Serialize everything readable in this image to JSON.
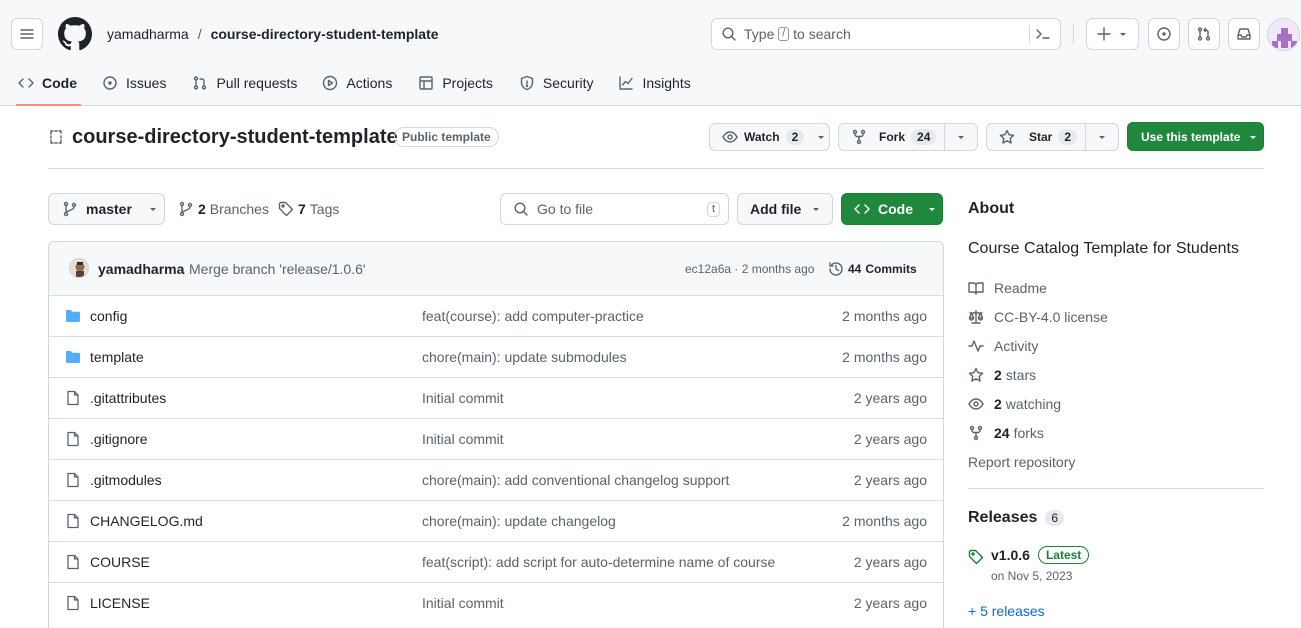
{
  "header": {
    "owner": "yamadharma",
    "separator": "/",
    "repo": "course-directory-student-template",
    "search_prefix": "Type",
    "search_key": "/",
    "search_suffix": "to search"
  },
  "nav": {
    "tabs": [
      {
        "label": "Code",
        "icon": "code-icon"
      },
      {
        "label": "Issues",
        "icon": "issue-icon"
      },
      {
        "label": "Pull requests",
        "icon": "pull-request-icon"
      },
      {
        "label": "Actions",
        "icon": "play-icon"
      },
      {
        "label": "Projects",
        "icon": "table-icon"
      },
      {
        "label": "Security",
        "icon": "shield-icon"
      },
      {
        "label": "Insights",
        "icon": "graph-icon"
      }
    ],
    "active": "Code"
  },
  "repo_head": {
    "title": "course-directory-student-template",
    "badge": "Public template",
    "watch_label": "Watch",
    "watch_count": "2",
    "fork_label": "Fork",
    "fork_count": "24",
    "star_label": "Star",
    "star_count": "2",
    "template_label": "Use this template"
  },
  "toolbar": {
    "branch": "master",
    "branches_count": "2",
    "branches_label": "Branches",
    "tags_count": "7",
    "tags_label": "Tags",
    "goto_placeholder": "Go to file",
    "goto_key": "t",
    "add_file": "Add file",
    "code_label": "Code"
  },
  "commit": {
    "author": "yamadharma",
    "message": "Merge branch 'release/1.0.6'",
    "hash_time": "ec12a6a · 2 months ago",
    "commits_count": "44",
    "commits_label": "Commits"
  },
  "files": [
    {
      "type": "dir",
      "name": "config",
      "message": "feat(course): add computer-practice",
      "age": "2 months ago"
    },
    {
      "type": "dir",
      "name": "template",
      "message": "chore(main): update submodules",
      "age": "2 months ago"
    },
    {
      "type": "file",
      "name": ".gitattributes",
      "message": "Initial commit",
      "age": "2 years ago"
    },
    {
      "type": "file",
      "name": ".gitignore",
      "message": "Initial commit",
      "age": "2 years ago"
    },
    {
      "type": "file",
      "name": ".gitmodules",
      "message": "chore(main): add conventional changelog support",
      "age": "2 years ago"
    },
    {
      "type": "file",
      "name": "CHANGELOG.md",
      "message": "chore(main): update changelog",
      "age": "2 months ago"
    },
    {
      "type": "file",
      "name": "COURSE",
      "message": "feat(script): add script for auto-determine name of course",
      "age": "2 years ago"
    },
    {
      "type": "file",
      "name": "LICENSE",
      "message": "Initial commit",
      "age": "2 years ago"
    }
  ],
  "about": {
    "heading": "About",
    "description": "Course Catalog Template for Students",
    "readme": "Readme",
    "license": "CC-BY-4.0 license",
    "activity": "Activity",
    "stars_count": "2",
    "stars_label": "stars",
    "watching_count": "2",
    "watching_label": "watching",
    "forks_count": "24",
    "forks_label": "forks",
    "report": "Report repository"
  },
  "releases": {
    "heading": "Releases",
    "count": "6",
    "latest_tag": "v1.0.6",
    "latest_badge": "Latest",
    "latest_date": "on Nov 5, 2023",
    "more": "+ 5 releases"
  },
  "colors": {
    "accent_green": "#1f883d",
    "folder_blue": "#54aeff",
    "tab_underline": "#fd8c73",
    "link_blue": "#0969da"
  }
}
